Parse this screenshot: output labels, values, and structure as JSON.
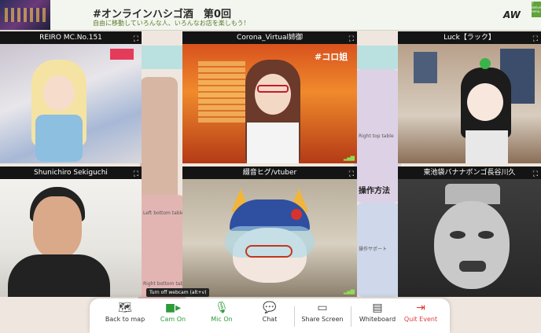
{
  "banner": {
    "title": "#オンラインハシゴ酒　第0回",
    "subtitle": "自由に移動していろんな人、いろんなお店を楽しもう！",
    "logo": "AW",
    "side_tag": "7 delive… remo…"
  },
  "background": {
    "heading": "操作方法",
    "table_labels": [
      "Right top table",
      "Left bottom table",
      "Right bottom table",
      "操作サポート"
    ]
  },
  "participants": [
    {
      "name": "REIRO MC.No.151"
    },
    {
      "name": "Corona_Virtual姉御"
    },
    {
      "name": "Luck【ラック】"
    },
    {
      "name": "Shunichiro Sekiguchi"
    },
    {
      "name": "綴音ヒグ/vtuber"
    },
    {
      "name": "東池袋バナナボンゴ長谷川久"
    }
  ],
  "tooltip": "Turn off webcam (alt+v)",
  "toolbar": {
    "back": "Back to map",
    "cam": "Cam On",
    "mic": "Mic On",
    "chat": "Chat",
    "share": "Share Screen",
    "whiteboard": "Whiteboard",
    "quit": "Quit Event"
  },
  "colors": {
    "active_green": "#2e9a3a",
    "quit_red": "#e03b3b",
    "signal_green": "#8fdc54"
  }
}
